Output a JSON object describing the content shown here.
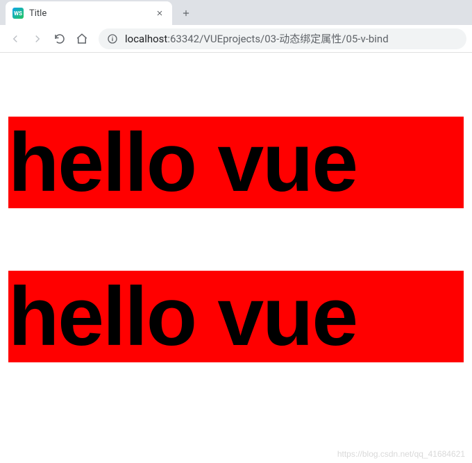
{
  "browser": {
    "tab": {
      "title": "Title",
      "favicon_label": "WS"
    },
    "url": {
      "host": "localhost",
      "port_and_path": ":63342/VUEprojects/03-动态绑定属性/05-v-bind"
    }
  },
  "page": {
    "heading1": "hello vue",
    "heading2": "hello vue"
  },
  "watermark": "https://blog.csdn.net/qq_41684621"
}
